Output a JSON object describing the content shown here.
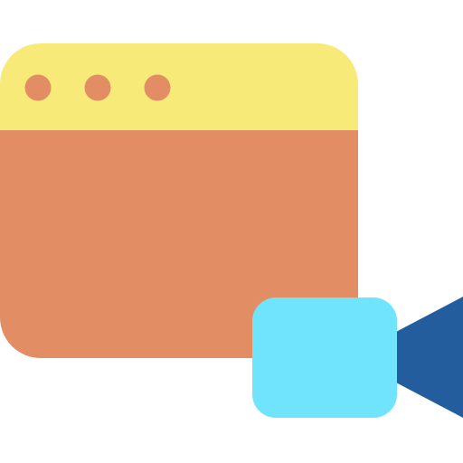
{
  "icon": {
    "name": "browser-video-icon",
    "colors": {
      "window_body": "#E28D64",
      "title_bar": "#F7EA79",
      "window_dots": "#E28D64",
      "camera_body": "#6FE4FC",
      "camera_lens": "#235D9E"
    }
  }
}
